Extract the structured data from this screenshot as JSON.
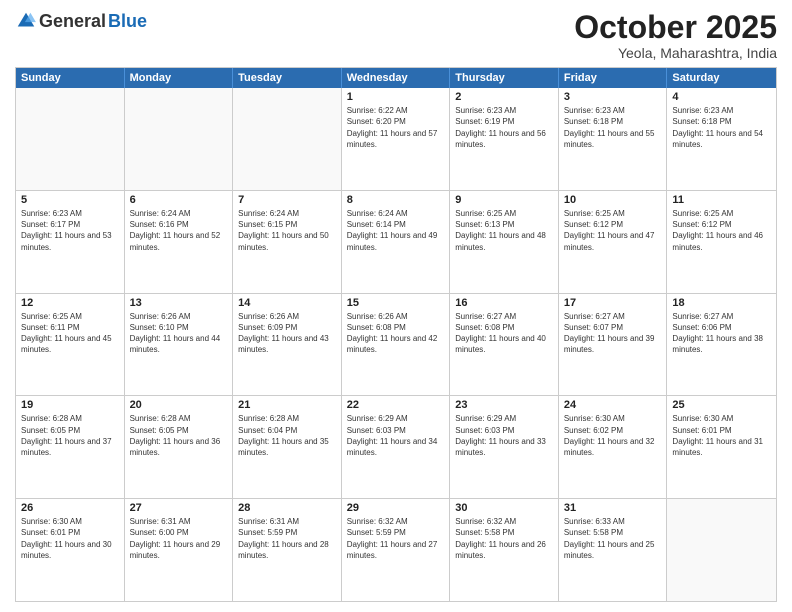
{
  "header": {
    "logo_general": "General",
    "logo_blue": "Blue",
    "month_title": "October 2025",
    "location": "Yeola, Maharashtra, India"
  },
  "weekdays": [
    "Sunday",
    "Monday",
    "Tuesday",
    "Wednesday",
    "Thursday",
    "Friday",
    "Saturday"
  ],
  "rows": [
    [
      {
        "day": "",
        "empty": true
      },
      {
        "day": "",
        "empty": true
      },
      {
        "day": "",
        "empty": true
      },
      {
        "day": "1",
        "sunrise": "Sunrise: 6:22 AM",
        "sunset": "Sunset: 6:20 PM",
        "daylight": "Daylight: 11 hours and 57 minutes."
      },
      {
        "day": "2",
        "sunrise": "Sunrise: 6:23 AM",
        "sunset": "Sunset: 6:19 PM",
        "daylight": "Daylight: 11 hours and 56 minutes."
      },
      {
        "day": "3",
        "sunrise": "Sunrise: 6:23 AM",
        "sunset": "Sunset: 6:18 PM",
        "daylight": "Daylight: 11 hours and 55 minutes."
      },
      {
        "day": "4",
        "sunrise": "Sunrise: 6:23 AM",
        "sunset": "Sunset: 6:18 PM",
        "daylight": "Daylight: 11 hours and 54 minutes."
      }
    ],
    [
      {
        "day": "5",
        "sunrise": "Sunrise: 6:23 AM",
        "sunset": "Sunset: 6:17 PM",
        "daylight": "Daylight: 11 hours and 53 minutes."
      },
      {
        "day": "6",
        "sunrise": "Sunrise: 6:24 AM",
        "sunset": "Sunset: 6:16 PM",
        "daylight": "Daylight: 11 hours and 52 minutes."
      },
      {
        "day": "7",
        "sunrise": "Sunrise: 6:24 AM",
        "sunset": "Sunset: 6:15 PM",
        "daylight": "Daylight: 11 hours and 50 minutes."
      },
      {
        "day": "8",
        "sunrise": "Sunrise: 6:24 AM",
        "sunset": "Sunset: 6:14 PM",
        "daylight": "Daylight: 11 hours and 49 minutes."
      },
      {
        "day": "9",
        "sunrise": "Sunrise: 6:25 AM",
        "sunset": "Sunset: 6:13 PM",
        "daylight": "Daylight: 11 hours and 48 minutes."
      },
      {
        "day": "10",
        "sunrise": "Sunrise: 6:25 AM",
        "sunset": "Sunset: 6:12 PM",
        "daylight": "Daylight: 11 hours and 47 minutes."
      },
      {
        "day": "11",
        "sunrise": "Sunrise: 6:25 AM",
        "sunset": "Sunset: 6:12 PM",
        "daylight": "Daylight: 11 hours and 46 minutes."
      }
    ],
    [
      {
        "day": "12",
        "sunrise": "Sunrise: 6:25 AM",
        "sunset": "Sunset: 6:11 PM",
        "daylight": "Daylight: 11 hours and 45 minutes."
      },
      {
        "day": "13",
        "sunrise": "Sunrise: 6:26 AM",
        "sunset": "Sunset: 6:10 PM",
        "daylight": "Daylight: 11 hours and 44 minutes."
      },
      {
        "day": "14",
        "sunrise": "Sunrise: 6:26 AM",
        "sunset": "Sunset: 6:09 PM",
        "daylight": "Daylight: 11 hours and 43 minutes."
      },
      {
        "day": "15",
        "sunrise": "Sunrise: 6:26 AM",
        "sunset": "Sunset: 6:08 PM",
        "daylight": "Daylight: 11 hours and 42 minutes."
      },
      {
        "day": "16",
        "sunrise": "Sunrise: 6:27 AM",
        "sunset": "Sunset: 6:08 PM",
        "daylight": "Daylight: 11 hours and 40 minutes."
      },
      {
        "day": "17",
        "sunrise": "Sunrise: 6:27 AM",
        "sunset": "Sunset: 6:07 PM",
        "daylight": "Daylight: 11 hours and 39 minutes."
      },
      {
        "day": "18",
        "sunrise": "Sunrise: 6:27 AM",
        "sunset": "Sunset: 6:06 PM",
        "daylight": "Daylight: 11 hours and 38 minutes."
      }
    ],
    [
      {
        "day": "19",
        "sunrise": "Sunrise: 6:28 AM",
        "sunset": "Sunset: 6:05 PM",
        "daylight": "Daylight: 11 hours and 37 minutes."
      },
      {
        "day": "20",
        "sunrise": "Sunrise: 6:28 AM",
        "sunset": "Sunset: 6:05 PM",
        "daylight": "Daylight: 11 hours and 36 minutes."
      },
      {
        "day": "21",
        "sunrise": "Sunrise: 6:28 AM",
        "sunset": "Sunset: 6:04 PM",
        "daylight": "Daylight: 11 hours and 35 minutes."
      },
      {
        "day": "22",
        "sunrise": "Sunrise: 6:29 AM",
        "sunset": "Sunset: 6:03 PM",
        "daylight": "Daylight: 11 hours and 34 minutes."
      },
      {
        "day": "23",
        "sunrise": "Sunrise: 6:29 AM",
        "sunset": "Sunset: 6:03 PM",
        "daylight": "Daylight: 11 hours and 33 minutes."
      },
      {
        "day": "24",
        "sunrise": "Sunrise: 6:30 AM",
        "sunset": "Sunset: 6:02 PM",
        "daylight": "Daylight: 11 hours and 32 minutes."
      },
      {
        "day": "25",
        "sunrise": "Sunrise: 6:30 AM",
        "sunset": "Sunset: 6:01 PM",
        "daylight": "Daylight: 11 hours and 31 minutes."
      }
    ],
    [
      {
        "day": "26",
        "sunrise": "Sunrise: 6:30 AM",
        "sunset": "Sunset: 6:01 PM",
        "daylight": "Daylight: 11 hours and 30 minutes."
      },
      {
        "day": "27",
        "sunrise": "Sunrise: 6:31 AM",
        "sunset": "Sunset: 6:00 PM",
        "daylight": "Daylight: 11 hours and 29 minutes."
      },
      {
        "day": "28",
        "sunrise": "Sunrise: 6:31 AM",
        "sunset": "Sunset: 5:59 PM",
        "daylight": "Daylight: 11 hours and 28 minutes."
      },
      {
        "day": "29",
        "sunrise": "Sunrise: 6:32 AM",
        "sunset": "Sunset: 5:59 PM",
        "daylight": "Daylight: 11 hours and 27 minutes."
      },
      {
        "day": "30",
        "sunrise": "Sunrise: 6:32 AM",
        "sunset": "Sunset: 5:58 PM",
        "daylight": "Daylight: 11 hours and 26 minutes."
      },
      {
        "day": "31",
        "sunrise": "Sunrise: 6:33 AM",
        "sunset": "Sunset: 5:58 PM",
        "daylight": "Daylight: 11 hours and 25 minutes."
      },
      {
        "day": "",
        "empty": true
      }
    ]
  ]
}
